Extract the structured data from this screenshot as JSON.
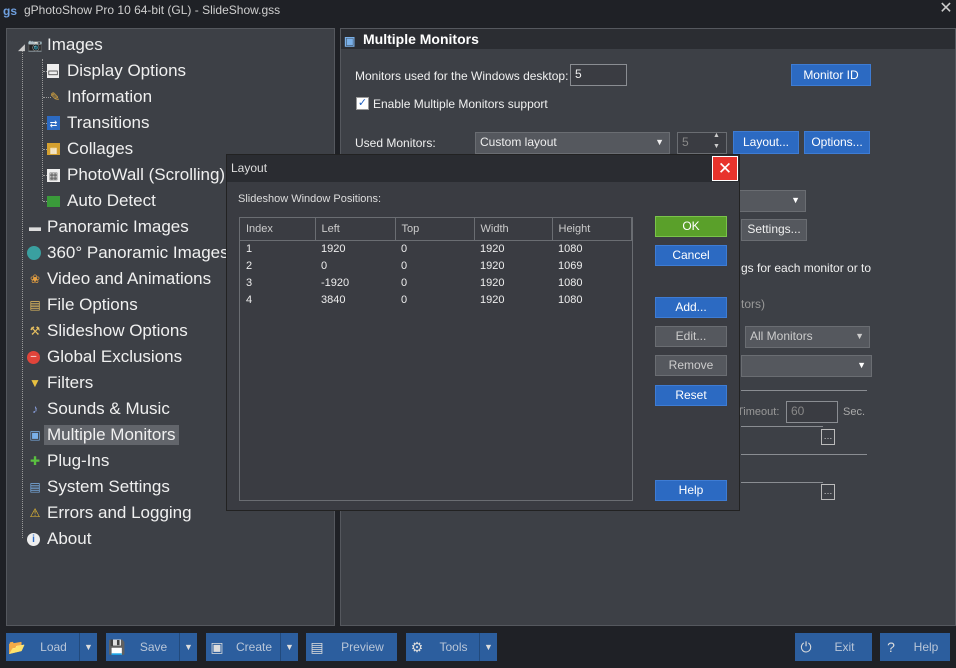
{
  "window": {
    "title": "gPhotoShow Pro 10 64-bit (GL) - SlideShow.gss",
    "close": "✕",
    "app_icon": "gs"
  },
  "tree": {
    "items": [
      {
        "label": "Images",
        "icon": "camera-icon"
      },
      {
        "label": "Display Options",
        "icon": "page-icon"
      },
      {
        "label": "Information",
        "icon": "info-palette-icon"
      },
      {
        "label": "Transitions",
        "icon": "transitions-icon"
      },
      {
        "label": "Collages",
        "icon": "collage-icon"
      },
      {
        "label": "PhotoWall (Scrolling)",
        "icon": "grid-icon"
      },
      {
        "label": "Auto Detect",
        "icon": "auto-detect-icon"
      },
      {
        "label": "Panoramic Images",
        "icon": "film-icon"
      },
      {
        "label": "360° Panoramic Images",
        "icon": "globe-icon"
      },
      {
        "label": "Video and Animations",
        "icon": "video-icon"
      },
      {
        "label": "File Options",
        "icon": "file-icon"
      },
      {
        "label": "Slideshow Options",
        "icon": "tools-icon"
      },
      {
        "label": "Global Exclusions",
        "icon": "exclusion-icon"
      },
      {
        "label": "Filters",
        "icon": "filter-icon"
      },
      {
        "label": "Sounds & Music",
        "icon": "music-icon"
      },
      {
        "label": "Multiple Monitors",
        "icon": "monitors-icon"
      },
      {
        "label": "Plug-Ins",
        "icon": "plugin-icon"
      },
      {
        "label": "System Settings",
        "icon": "settings-icon"
      },
      {
        "label": "Errors and Logging",
        "icon": "warning-icon"
      },
      {
        "label": "About",
        "icon": "about-icon"
      }
    ]
  },
  "panel": {
    "title": "Multiple Monitors",
    "monitors_desktop_label": "Monitors used for the Windows desktop:",
    "monitors_desktop_value": "5",
    "monitor_id_button": "Monitor ID",
    "enable_multi_label": "Enable Multiple Monitors support",
    "enable_multi_checked": true,
    "used_monitors_label": "Used Monitors:",
    "used_monitors_value": "Custom layout",
    "used_monitors_count": "5",
    "layout_button": "Layout...",
    "options_button": "Options...",
    "settings_button": "Settings...",
    "partial_text_1": "gs for each monitor or to",
    "partial_text_2": "tors)",
    "all_monitors_value": "All Monitors",
    "timeout_label": "Timeout:",
    "timeout_value": "60",
    "timeout_unit": "Sec."
  },
  "dialog": {
    "title": "Layout",
    "section_label": "Slideshow Window Positions:",
    "columns": [
      "Index",
      "Left",
      "Top",
      "Width",
      "Height"
    ],
    "rows": [
      [
        "1",
        "1920",
        "0",
        "1920",
        "1080"
      ],
      [
        "2",
        "0",
        "0",
        "1920",
        "1069"
      ],
      [
        "3",
        "-1920",
        "0",
        "1920",
        "1080"
      ],
      [
        "4",
        "3840",
        "0",
        "1920",
        "1080"
      ]
    ],
    "ok": "OK",
    "cancel": "Cancel",
    "add": "Add...",
    "edit": "Edit...",
    "remove": "Remove",
    "reset": "Reset",
    "help": "Help"
  },
  "bottom": {
    "load": "Load",
    "save": "Save",
    "create": "Create",
    "preview": "Preview",
    "tools": "Tools",
    "exit": "Exit",
    "help": "Help"
  }
}
